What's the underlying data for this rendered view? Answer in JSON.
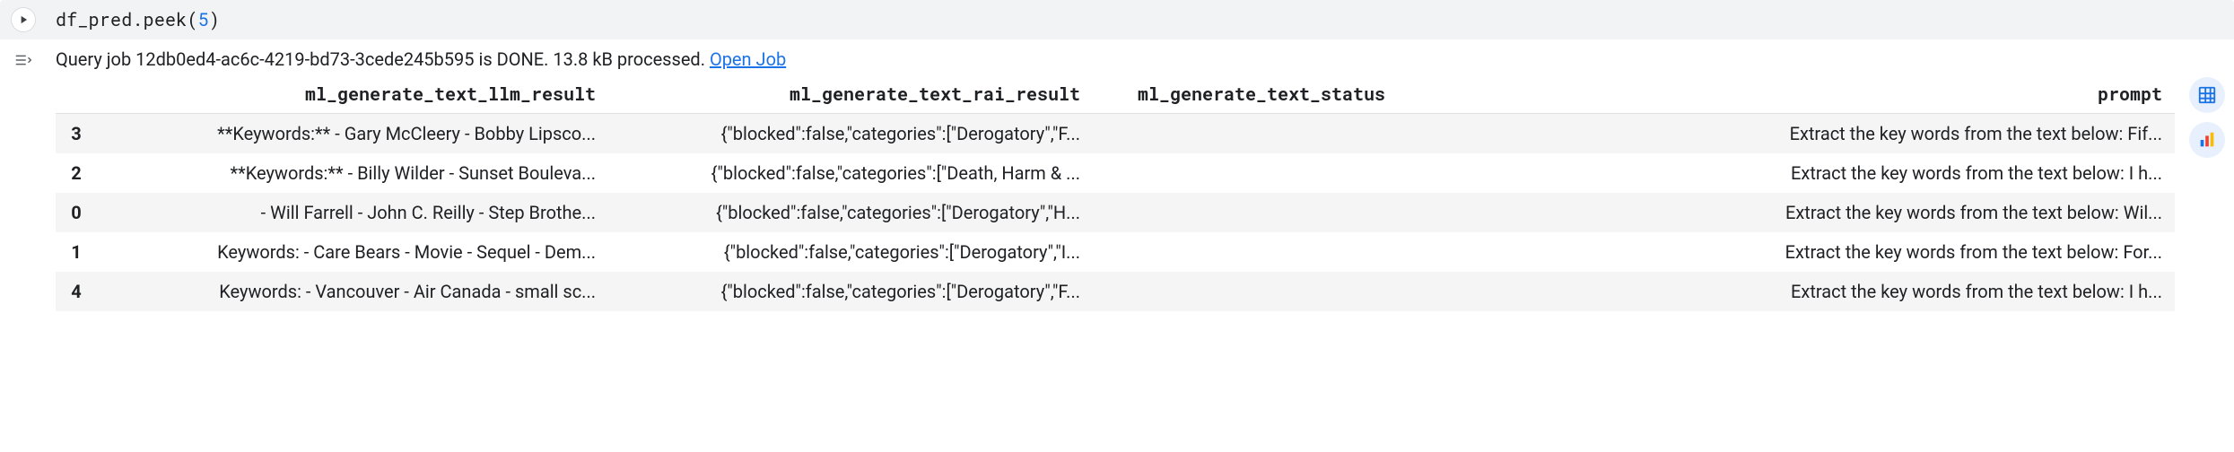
{
  "input": {
    "code_obj": "df_pred",
    "code_method": "peek",
    "code_arg": "5"
  },
  "output": {
    "status_prefix": "Query job ",
    "job_id": "12db0ed4-ac6c-4219-bd73-3cede245b595",
    "status_mid": " is DONE. 13.8 kB processed. ",
    "open_job_label": "Open Job"
  },
  "table": {
    "columns": [
      "ml_generate_text_llm_result",
      "ml_generate_text_rai_result",
      "ml_generate_text_status",
      "prompt"
    ],
    "rows": [
      {
        "idx": "3",
        "c0": "**Keywords:** - Gary McCleery - Bobby Lipsco...",
        "c1": "{\"blocked\":false,\"categories\":[\"Derogatory\",\"F...",
        "c2": "",
        "c3": "Extract the key words from the text below: Fif..."
      },
      {
        "idx": "2",
        "c0": "**Keywords:** - Billy Wilder - Sunset Bouleva...",
        "c1": "{\"blocked\":false,\"categories\":[\"Death, Harm & ...",
        "c2": "",
        "c3": "Extract the key words from the text below: I h..."
      },
      {
        "idx": "0",
        "c0": "- Will Farrell - John C. Reilly - Step Brothe...",
        "c1": "{\"blocked\":false,\"categories\":[\"Derogatory\",\"H...",
        "c2": "",
        "c3": "Extract the key words from the text below: Wil..."
      },
      {
        "idx": "1",
        "c0": "Keywords: - Care Bears - Movie - Sequel - Dem...",
        "c1": "{\"blocked\":false,\"categories\":[\"Derogatory\",\"I...",
        "c2": "",
        "c3": "Extract the key words from the text below: For..."
      },
      {
        "idx": "4",
        "c0": "Keywords: - Vancouver - Air Canada - small sc...",
        "c1": "{\"blocked\":false,\"categories\":[\"Derogatory\",\"F...",
        "c2": "",
        "c3": "Extract the key words from the text below: I h..."
      }
    ]
  }
}
